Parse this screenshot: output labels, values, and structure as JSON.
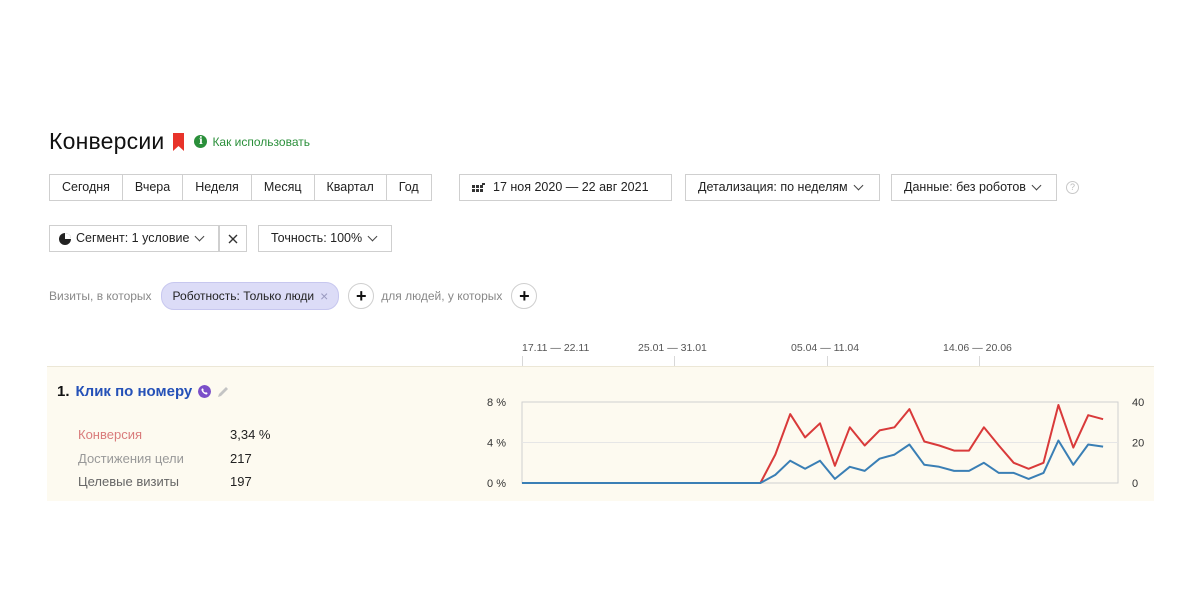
{
  "header": {
    "title": "Конверсии",
    "help_link": "Как использовать"
  },
  "periods": [
    "Сегодня",
    "Вчера",
    "Неделя",
    "Месяц",
    "Квартал",
    "Год"
  ],
  "date_range": "17 ноя 2020 — 22 авг 2021",
  "detail_select": "Детализация: по неделям",
  "data_select": "Данные: без роботов",
  "segment_select": "Сегмент: 1 условие",
  "accuracy_select": "Точность: 100%",
  "filter": {
    "prefix": "Визиты, в которых",
    "chip": "Роботность: Только люди",
    "suffix": "для людей, у которых"
  },
  "timeline_labels": [
    "17.11 — 22.11",
    "25.01 — 31.01",
    "05.04 — 11.04",
    "14.06 — 20.06"
  ],
  "goal": {
    "number": "1.",
    "name": "Клик по номеру",
    "metrics": [
      {
        "label": "Конверсия",
        "value": "3,34 %",
        "color": "#d97b7b"
      },
      {
        "label": "Достижения цели",
        "value": "217",
        "color": "#999999"
      },
      {
        "label": "Целевые визиты",
        "value": "197",
        "color": "#666666"
      }
    ]
  },
  "colors": {
    "red_series": "#d93a3a",
    "blue_series": "#3a7fb5",
    "accent_green": "#2a8f3a",
    "link_blue": "#2551b8"
  },
  "chart_data": {
    "type": "line",
    "left_axis": {
      "ticks": [
        "8 %",
        "4 %",
        "0 %"
      ],
      "ylim": [
        0,
        8
      ]
    },
    "right_axis": {
      "ticks": [
        "40",
        "20",
        "0"
      ],
      "ylim": [
        0,
        40
      ]
    },
    "x_count": 41,
    "series": [
      {
        "axis": "left",
        "values": [
          0,
          0,
          0,
          0,
          0,
          0,
          0,
          0,
          0,
          0,
          0,
          0,
          0,
          0,
          0,
          0,
          0,
          2.8,
          6.8,
          4.5,
          5.9,
          1.7,
          5.5,
          3.7,
          5.2,
          5.5,
          7.3,
          4.1,
          3.7,
          3.2,
          3.2,
          5.5,
          3.7,
          2.0,
          1.4,
          2.0,
          7.7,
          3.5,
          6.7,
          6.3
        ]
      },
      {
        "axis": "right",
        "values": [
          0,
          0,
          0,
          0,
          0,
          0,
          0,
          0,
          0,
          0,
          0,
          0,
          0,
          0,
          0,
          0,
          0,
          4,
          11,
          7,
          11,
          2,
          8,
          6,
          12,
          14,
          19,
          9,
          8,
          6,
          6,
          10,
          5,
          5,
          2,
          5,
          21,
          9,
          19,
          18
        ]
      }
    ]
  }
}
